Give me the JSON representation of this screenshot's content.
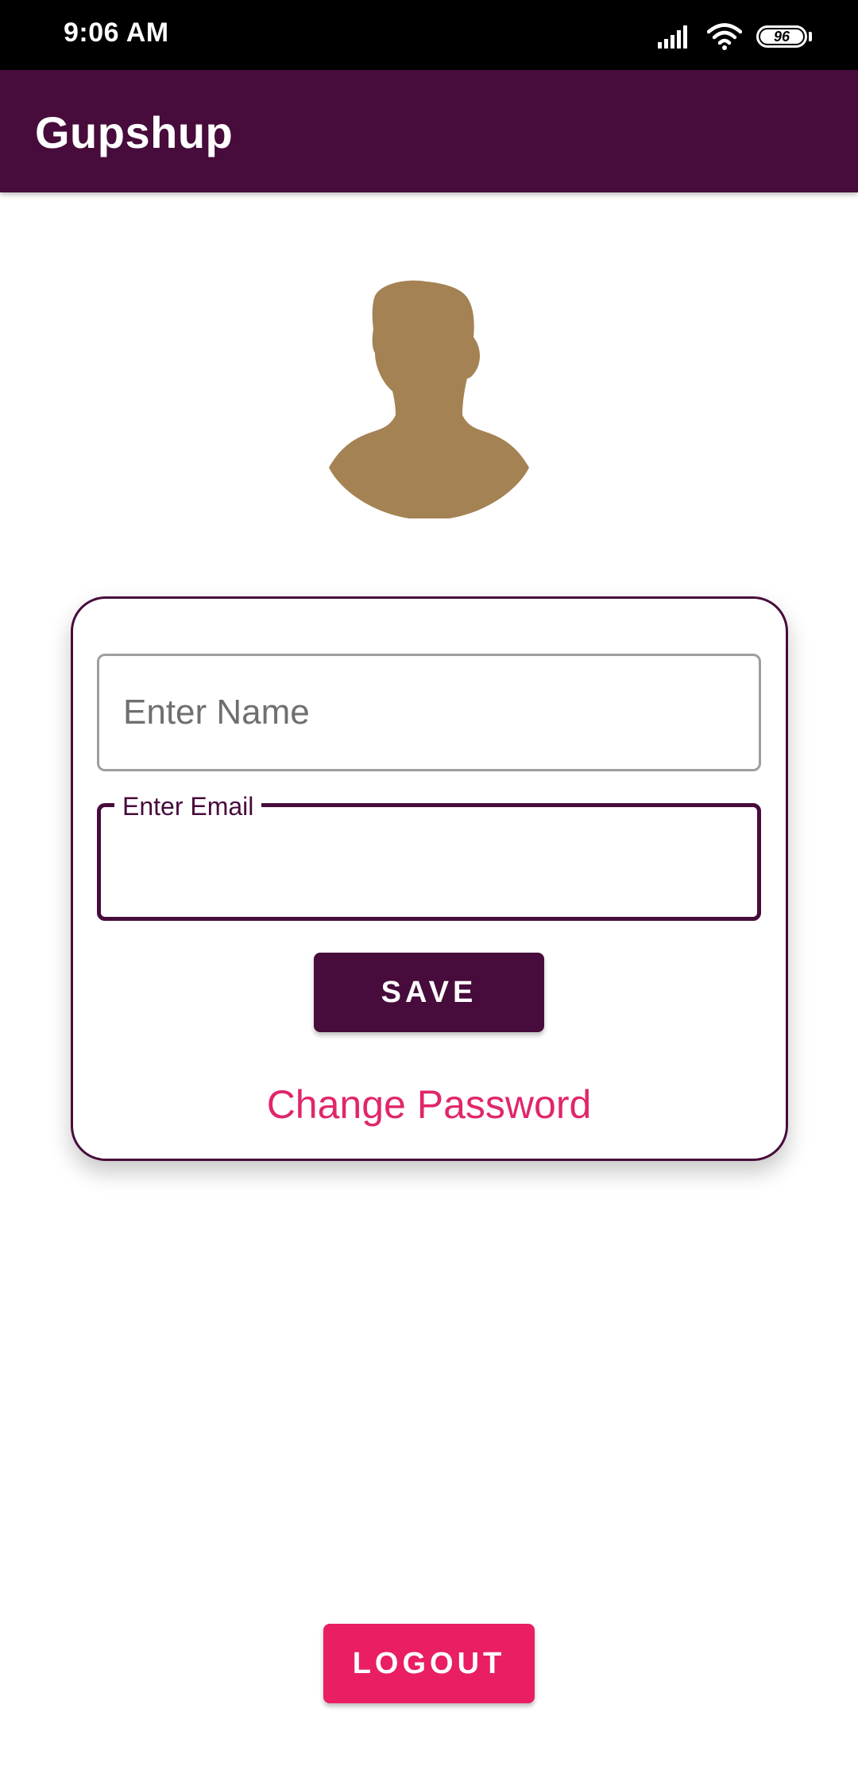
{
  "status_bar": {
    "time": "9:06 AM",
    "battery_level": "96",
    "icons": [
      "signal-icon",
      "wifi-icon",
      "battery-icon"
    ]
  },
  "app_bar": {
    "title": "Gupshup",
    "color": "#470c3b"
  },
  "profile": {
    "avatar_icon": "person-silhouette-icon",
    "avatar_color": "#a48253"
  },
  "form": {
    "name_placeholder": "Enter Name",
    "name_value": "",
    "email_label": "Enter Email",
    "email_value": "",
    "save_label": "SAVE",
    "change_password_label": "Change Password"
  },
  "logout_label": "LOGOUT",
  "colors": {
    "primary": "#470c3b",
    "accent": "#e91e63",
    "link": "#e0266c"
  }
}
